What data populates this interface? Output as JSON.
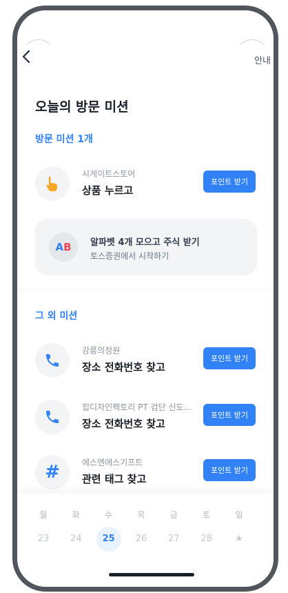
{
  "header": {
    "back_icon": "chevron-left-icon",
    "guide_label": "안내"
  },
  "page_title": "오늘의 방문 미션",
  "visit_section": {
    "title": "방문 미션 1개",
    "missions": [
      {
        "icon": "pointing-hand-icon",
        "store": "시게이트스토어",
        "task": "상품 누르고",
        "button": "포인트 받기"
      }
    ]
  },
  "banner": {
    "icon_text_a": "A",
    "icon_text_b": "B",
    "title": "알파벳 4개 모으고 주식 받기",
    "subtitle": "토스증권에서 시작하기"
  },
  "other_section": {
    "title": "그 외 미션",
    "missions": [
      {
        "icon": "phone-icon",
        "store": "강릉의정원",
        "task": "장소 전화번호 찾고",
        "button": "포인트 받기"
      },
      {
        "icon": "phone-icon",
        "store": "힙디자인팩토리 PT 검단 신도...",
        "task": "장소 전화번호 찾고",
        "button": "포인트 받기"
      },
      {
        "icon": "hashtag-icon",
        "store": "에스엔에스기프트",
        "task": "관련 태그 찾고",
        "button": "포인트 받기"
      }
    ]
  },
  "calendar": {
    "weekdays": [
      "월",
      "화",
      "수",
      "목",
      "금",
      "토",
      "일"
    ],
    "dates": [
      "23",
      "24",
      "25",
      "26",
      "27",
      "28",
      "★"
    ],
    "today": "25"
  },
  "colors": {
    "accent": "#3182f6",
    "red": "#f04452",
    "hand": "#f5a623",
    "bezel": "#51565c"
  }
}
